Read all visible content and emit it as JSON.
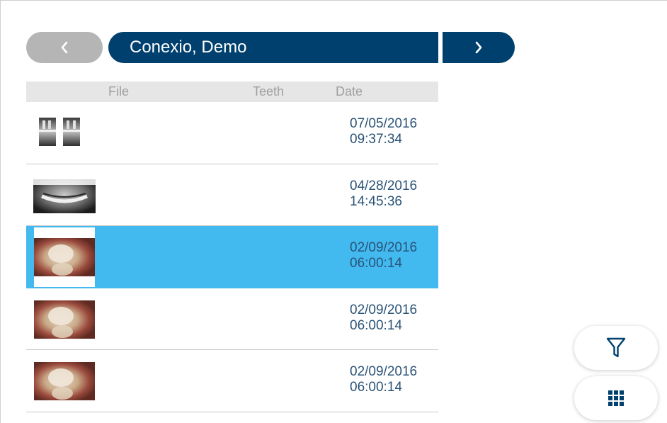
{
  "header": {
    "patient_name": "Conexio, Demo"
  },
  "table": {
    "columns": [
      "File",
      "Teeth",
      "Date"
    ]
  },
  "rows": [
    {
      "thumb": "bitewing-xray",
      "date": "07/05/2016",
      "time": "09:37:34",
      "teeth": "",
      "selected": false
    },
    {
      "thumb": "panoramic-xray",
      "date": "04/28/2016",
      "time": "14:45:36",
      "teeth": "",
      "selected": false
    },
    {
      "thumb": "intraoral-photo",
      "date": "02/09/2016",
      "time": "06:00:14",
      "teeth": "",
      "selected": true
    },
    {
      "thumb": "intraoral-photo",
      "date": "02/09/2016",
      "time": "06:00:14",
      "teeth": "",
      "selected": false
    },
    {
      "thumb": "intraoral-photo",
      "date": "02/09/2016",
      "time": "06:00:14",
      "teeth": "",
      "selected": false
    }
  ],
  "icons": {
    "prev": "chevron-left-icon",
    "next": "chevron-right-icon",
    "filter": "filter-icon",
    "grid": "grid-icon"
  },
  "colors": {
    "primary": "#00406e",
    "disabled": "#b5b5b5",
    "selection": "#42b9ef",
    "date_text": "#2a5377",
    "header_bg": "#e6e6e6",
    "header_text": "#9f9f9f"
  }
}
